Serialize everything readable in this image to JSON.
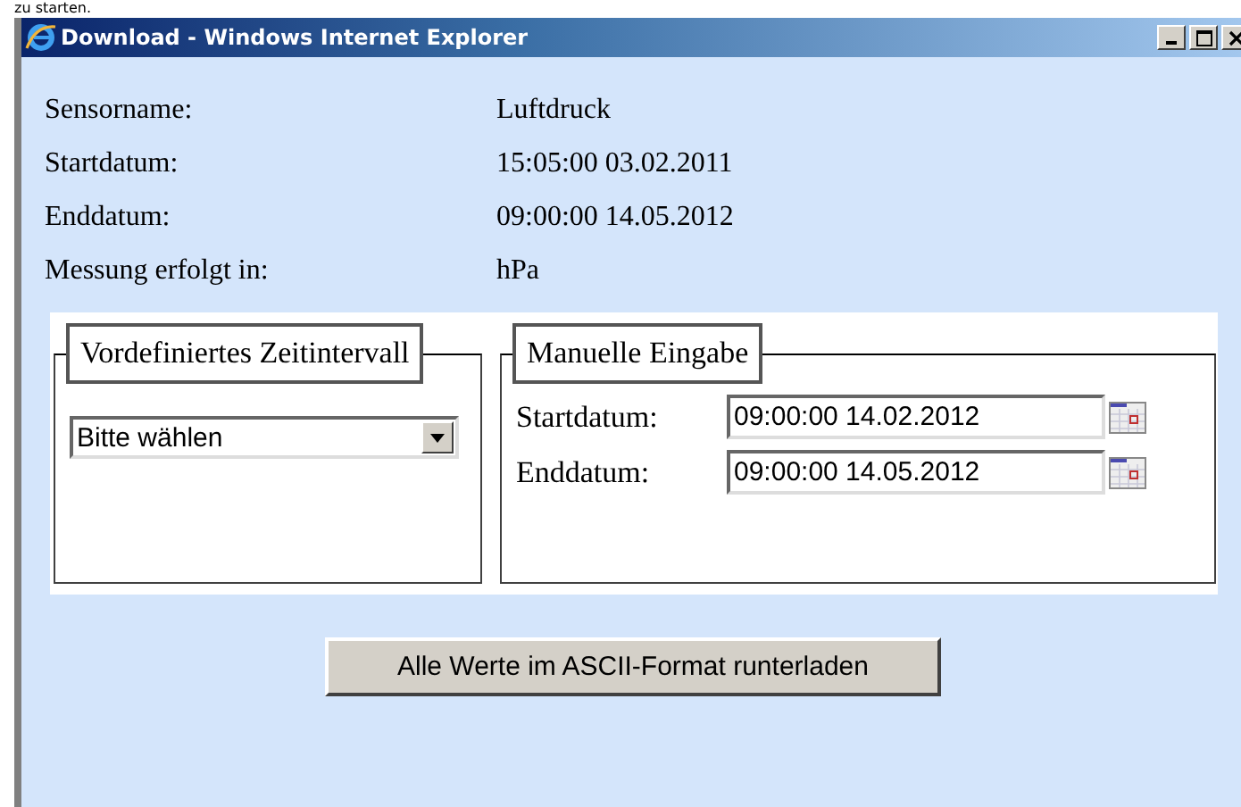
{
  "page_text": "zu starten.",
  "window": {
    "title": "Download - Windows Internet Explorer"
  },
  "info": [
    {
      "label": "Sensorname:",
      "value": "Luftdruck"
    },
    {
      "label": "Startdatum:",
      "value": "15:05:00 03.02.2011"
    },
    {
      "label": "Enddatum:",
      "value": "09:00:00 14.05.2012"
    },
    {
      "label": "Messung erfolgt in:",
      "value": "hPa"
    }
  ],
  "predefined": {
    "legend": "Vordefiniertes Zeitintervall",
    "select_value": "Bitte wählen"
  },
  "manual": {
    "legend": "Manuelle Eingabe",
    "fields": [
      {
        "label": "Startdatum:",
        "value": "09:00:00 14.02.2012"
      },
      {
        "label": "Enddatum:",
        "value": "09:00:00 14.05.2012"
      }
    ]
  },
  "button": "Alle Werte im ASCII-Format runterladen"
}
